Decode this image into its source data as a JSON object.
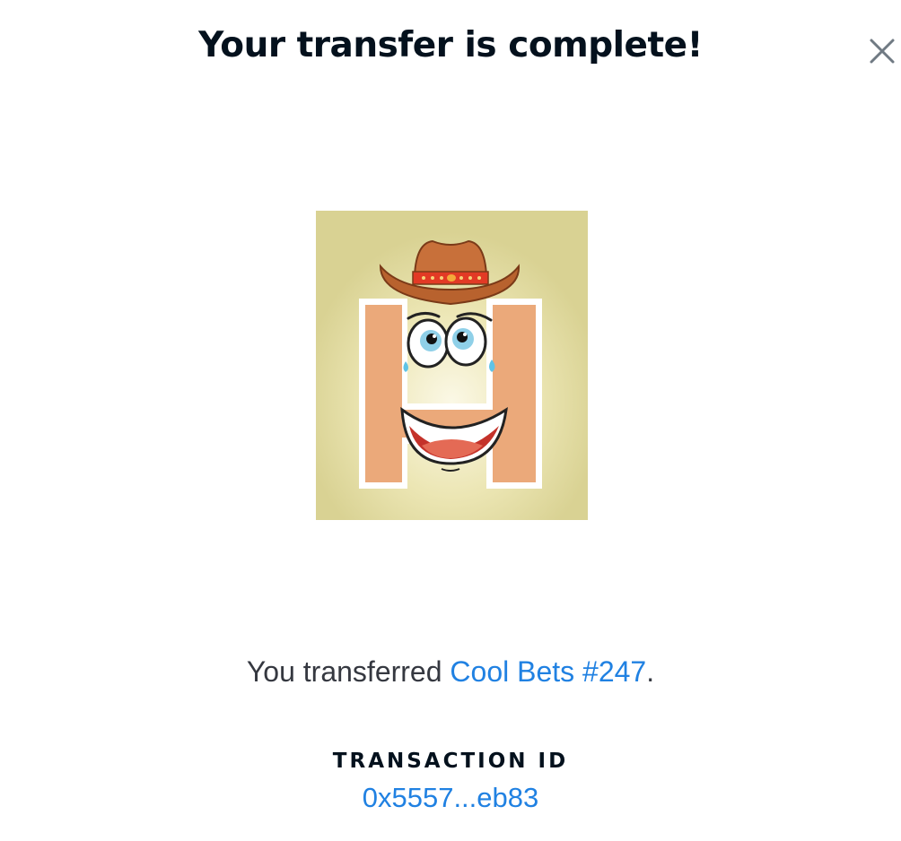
{
  "modal": {
    "title": "Your transfer is complete!",
    "close_icon": "close-icon"
  },
  "nft": {
    "image_alt": "Cool Bets #247",
    "image_description_icon": "nft-artwork-letter-h-cowboy-hat-face"
  },
  "message": {
    "prefix": "You transferred ",
    "item_name": "Cool Bets #247",
    "suffix": "."
  },
  "transaction": {
    "label": "TRANSACTION ID",
    "id": "0x5557...eb83"
  },
  "colors": {
    "title": "#04111d",
    "body_text": "#353840",
    "link": "#2081e2",
    "close_icon": "#707a83",
    "image_background": "#d9d293"
  }
}
